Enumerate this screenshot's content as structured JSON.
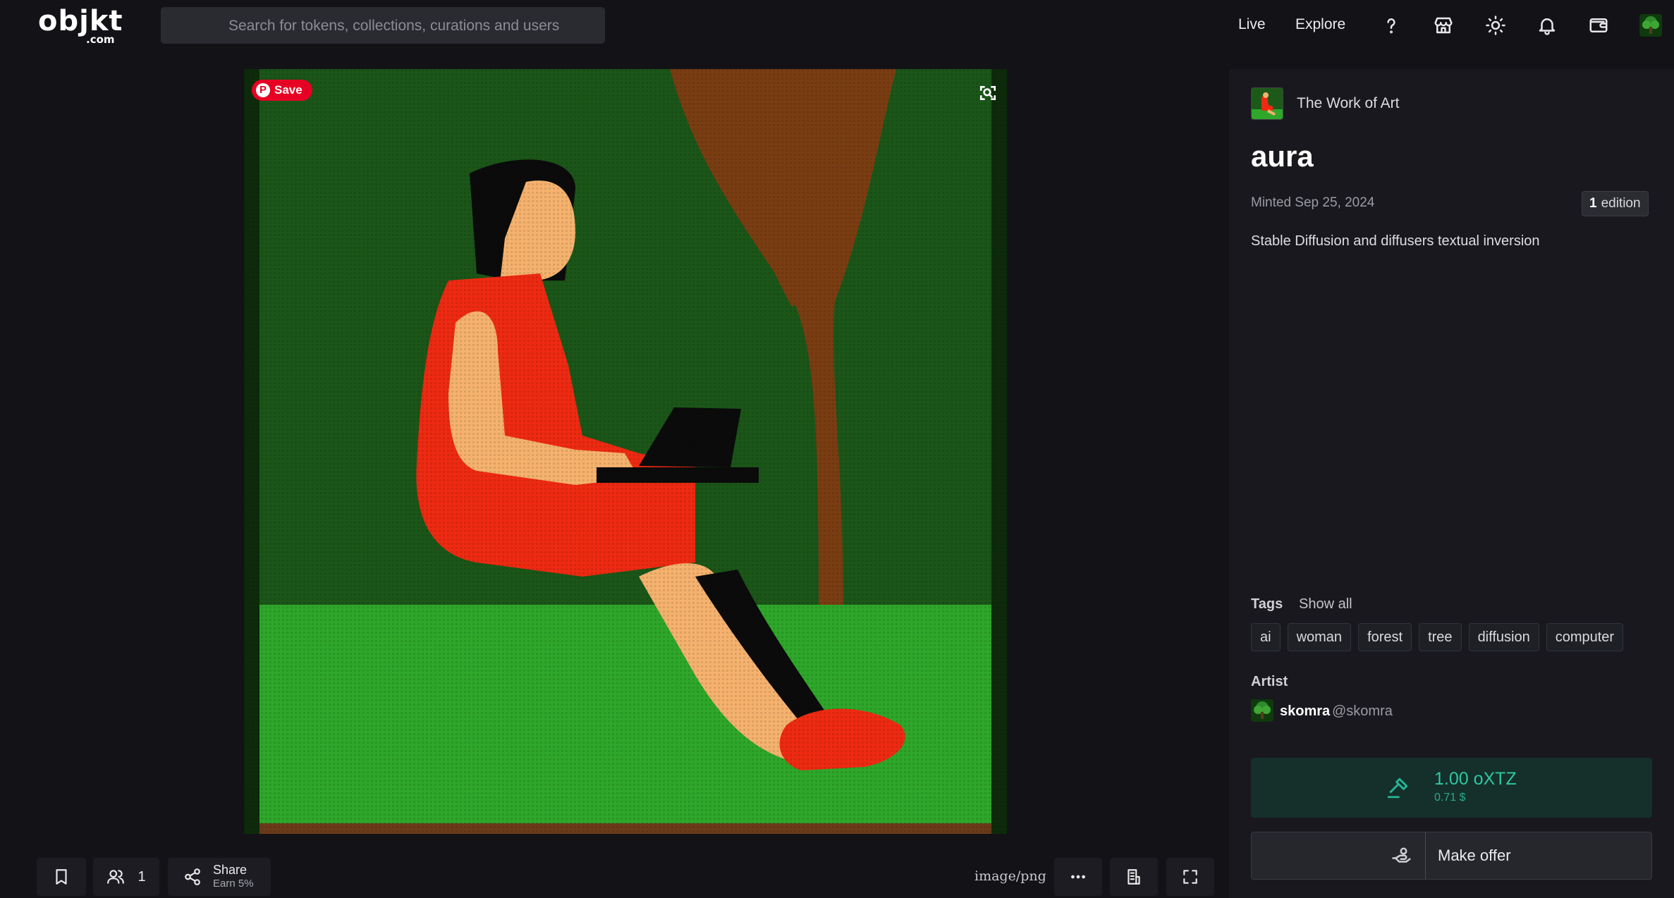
{
  "header": {
    "logo_main": "objkt",
    "logo_sub": ".com",
    "search_placeholder": "Search for tokens, collections, curations and users",
    "nav": {
      "live": "Live",
      "explore": "Explore"
    },
    "icons": [
      "help-icon",
      "shop-icon",
      "theme-icon",
      "bell-icon",
      "wallet-icon"
    ]
  },
  "artwork": {
    "pin_save": {
      "logo": "P",
      "label": "Save"
    },
    "mime_type": "image/png"
  },
  "toolbar": {
    "owners_count": "1",
    "share_label": "Share",
    "share_sub": "Earn 5%"
  },
  "token": {
    "collection": "The Work of Art",
    "title": "aura",
    "minted": "Minted Sep 25, 2024",
    "edition_count": "1",
    "edition_label": "edition",
    "description": "Stable Diffusion and diffusers textual inversion"
  },
  "tags": {
    "label": "Tags",
    "show_all": "Show all",
    "items": [
      "ai",
      "woman",
      "forest",
      "tree",
      "diffusion",
      "computer"
    ]
  },
  "artist": {
    "label": "Artist",
    "name": "skomra",
    "handle": "@skomra"
  },
  "buy": {
    "price": "1.00 oXTZ",
    "usd": "0.71 $"
  },
  "offer": {
    "label": "Make offer"
  },
  "colors": {
    "background": "#121217",
    "panel": "#18181e",
    "accent_green": "#2fc7a2",
    "pinterest_red": "#e60023"
  }
}
